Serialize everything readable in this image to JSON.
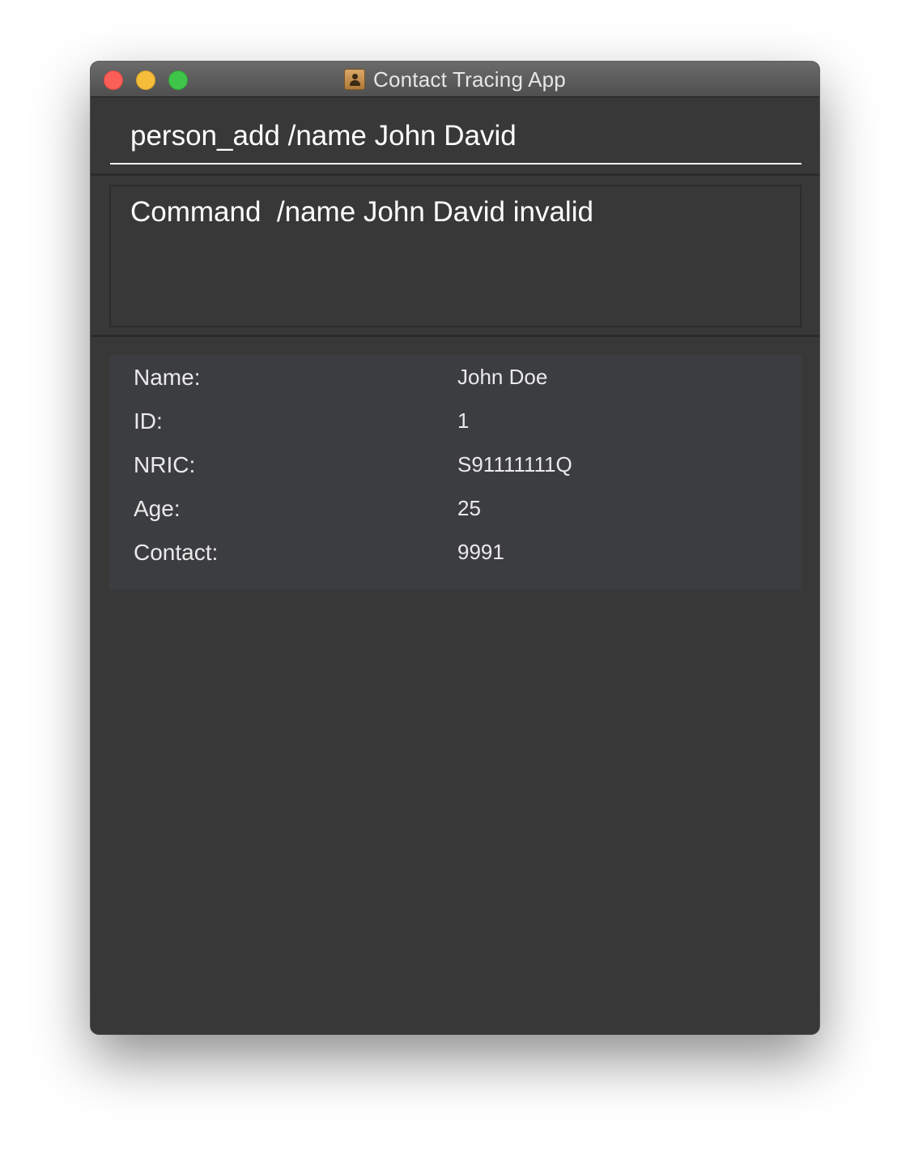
{
  "window": {
    "title": "Contact Tracing App",
    "app_icon": "contacts-icon",
    "controls": [
      "close",
      "minimize",
      "zoom"
    ]
  },
  "command_input": {
    "value": "person_add /name John David"
  },
  "result_display": {
    "message": "Command  /name John David invalid"
  },
  "person_details": {
    "rows": [
      {
        "label": "Name:",
        "value": "John Doe"
      },
      {
        "label": "ID:",
        "value": "1"
      },
      {
        "label": "NRIC:",
        "value": "S91111111Q"
      },
      {
        "label": "Age:",
        "value": "25"
      },
      {
        "label": "Contact:",
        "value": "9991"
      }
    ]
  },
  "colors": {
    "background": "#383838",
    "panel": "#3c3d40",
    "text": "#ffffff"
  }
}
